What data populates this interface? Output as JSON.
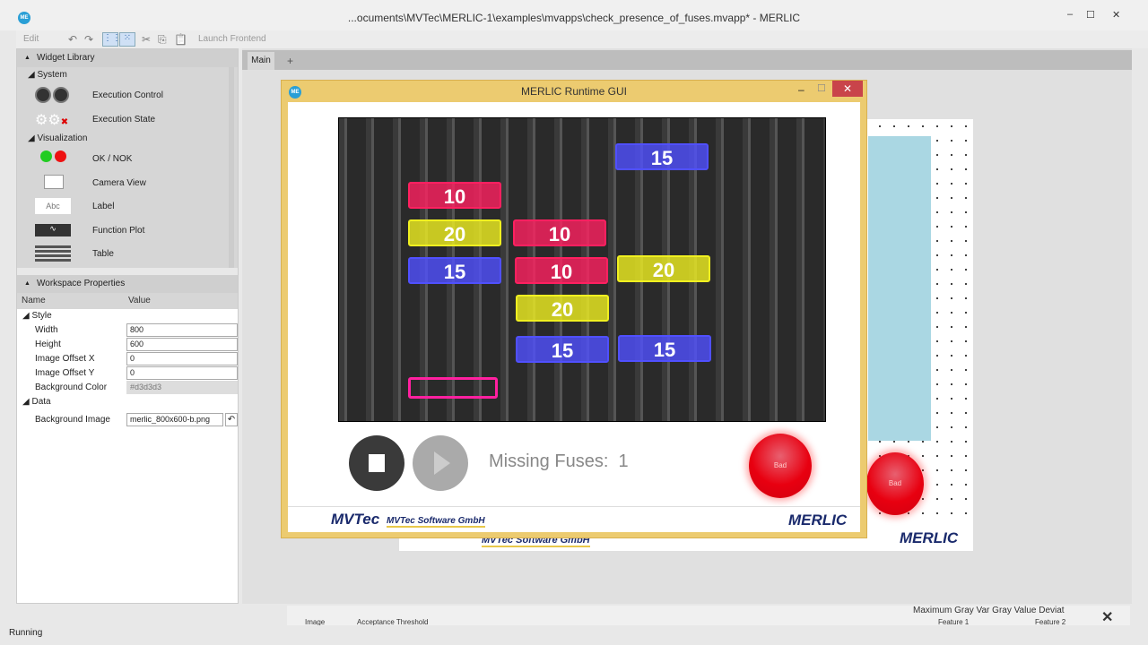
{
  "window": {
    "title": "...ocuments\\MVTec\\MERLIC-1\\examples\\mvapps\\check_presence_of_fuses.mvapp* - MERLIC",
    "minimize": "–",
    "maximize": "☐",
    "close": "✕",
    "app_icon": "ME"
  },
  "toolbar": {
    "edit": "Edit",
    "launch_frontend": "Launch Frontend",
    "undo": "↶",
    "redo": "↷",
    "cut": "✂",
    "copy": "⎘",
    "paste": "📋"
  },
  "widget_library": {
    "title": "Widget Library",
    "groups": [
      {
        "name": "System",
        "items": [
          {
            "label": "Execution Control"
          },
          {
            "label": "Execution State"
          }
        ]
      },
      {
        "name": "Visualization",
        "items": [
          {
            "label": "OK / NOK"
          },
          {
            "label": "Camera View"
          },
          {
            "label": "Label",
            "icon_text": "Abc"
          },
          {
            "label": "Function Plot"
          },
          {
            "label": "Table"
          }
        ]
      }
    ]
  },
  "workspace_properties": {
    "title": "Workspace Properties",
    "col_name": "Name",
    "col_value": "Value",
    "style_group": "Style",
    "data_group": "Data",
    "rows": [
      {
        "name": "Width",
        "value": "800"
      },
      {
        "name": "Height",
        "value": "600"
      },
      {
        "name": "Image Offset X",
        "value": "0"
      },
      {
        "name": "Image Offset Y",
        "value": "0"
      },
      {
        "name": "Background Color",
        "value": "#d3d3d3"
      }
    ],
    "data_rows": [
      {
        "name": "Background Image",
        "value": "merlic_800x600-b.png"
      }
    ]
  },
  "tabs": {
    "main": "Main",
    "add": "+"
  },
  "runtime": {
    "title": "MERLIC Runtime GUI",
    "missing_label": "Missing Fuses:",
    "missing_value": "1",
    "led_text": "Bad",
    "company": "MVTec Software GmbH",
    "brand": "MERLIC",
    "logo_mark": "MVTec",
    "fuses": [
      {
        "label": "15",
        "color": "#5050ff"
      },
      {
        "label": "10",
        "color": "#ff2060"
      },
      {
        "label": "20",
        "color": "#f0f020"
      },
      {
        "label": "10",
        "color": "#ff2060"
      },
      {
        "label": "15",
        "color": "#5050ff"
      },
      {
        "label": "10",
        "color": "#ff2060"
      },
      {
        "label": "20",
        "color": "#f0f020"
      },
      {
        "label": "20",
        "color": "#f0f020"
      },
      {
        "label": "15",
        "color": "#5050ff"
      },
      {
        "label": "15",
        "color": "#5050ff"
      },
      {
        "label": "",
        "color": "#ff20a0"
      }
    ]
  },
  "background_ws": {
    "led_text": "Bad",
    "brand": "MERLIC",
    "company": "MVTec Software GmbH"
  },
  "bottom": {
    "col1": "Image",
    "col2": "Acceptance Threshold",
    "col3": "Feature 1",
    "col4": "Feature 2",
    "header_partial": "Maximum Gray Var  Gray Value Deviat"
  },
  "status": "Running"
}
